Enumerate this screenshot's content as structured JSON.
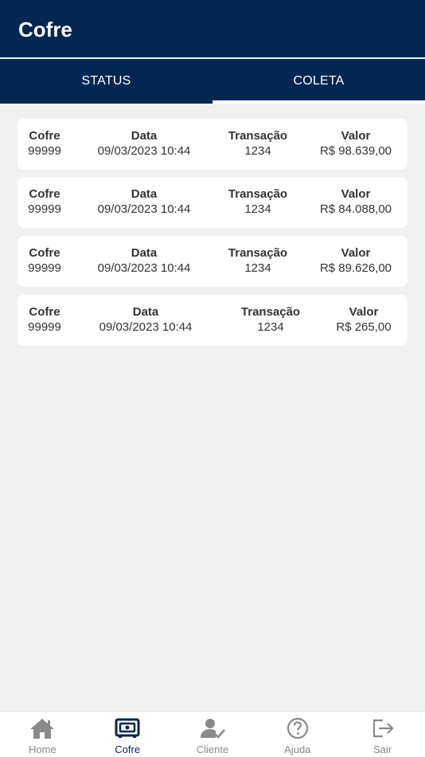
{
  "header": {
    "title": "Cofre"
  },
  "tabs": [
    {
      "label": "STATUS",
      "active": false
    },
    {
      "label": "COLETA",
      "active": true
    }
  ],
  "columns": {
    "cofre": "Cofre",
    "data": "Data",
    "transacao": "Transação",
    "valor": "Valor"
  },
  "rows": [
    {
      "cofre": "99999",
      "data": "09/03/2023 10:44",
      "transacao": "1234",
      "valor": "R$ 98.639,00"
    },
    {
      "cofre": "99999",
      "data": "09/03/2023 10:44",
      "transacao": "1234",
      "valor": "R$ 84.088,00"
    },
    {
      "cofre": "99999",
      "data": "09/03/2023 10:44",
      "transacao": "1234",
      "valor": "R$ 89.626,00"
    },
    {
      "cofre": "99999",
      "data": "09/03/2023 10:44",
      "transacao": "1234",
      "valor": "R$ 265,00"
    }
  ],
  "bottom_nav": [
    {
      "label": "Home",
      "icon": "home-icon"
    },
    {
      "label": "Cofre",
      "icon": "safe-icon",
      "active": true
    },
    {
      "label": "Cliente",
      "icon": "user-check-icon"
    },
    {
      "label": "Ajuda",
      "icon": "help-icon"
    },
    {
      "label": "Sair",
      "icon": "logout-icon"
    }
  ],
  "colors": {
    "primary": "#042652",
    "background": "#f1f1f1",
    "inactive": "#888888"
  }
}
